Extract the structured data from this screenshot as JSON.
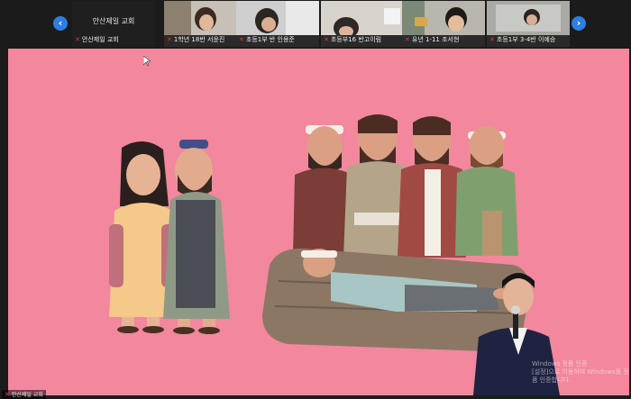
{
  "strip": {
    "prev_icon": "chevron-left-icon",
    "next_icon": "chevron-right-icon",
    "host_tile": {
      "center_name": "안산제일 교회",
      "label": "안산제일 교회"
    },
    "participants": [
      {
        "label": "1학년 18반 서윤진"
      },
      {
        "label": "초등1부 반 인용준"
      },
      {
        "label": "초등부16 반고이림"
      },
      {
        "label": "유년 1-11 조서현"
      },
      {
        "label": "초등1부 3-4반 이예승"
      }
    ]
  },
  "main": {
    "speaker_label": "안산제일 교회",
    "watermark_line1": "Windows 정품 인증",
    "watermark_line2": "[설정]으로 이동하여 Windows를 정품 인증합니다."
  },
  "colors": {
    "stage_bg": "#f2879e",
    "nav_accent": "#2f7ee0"
  }
}
